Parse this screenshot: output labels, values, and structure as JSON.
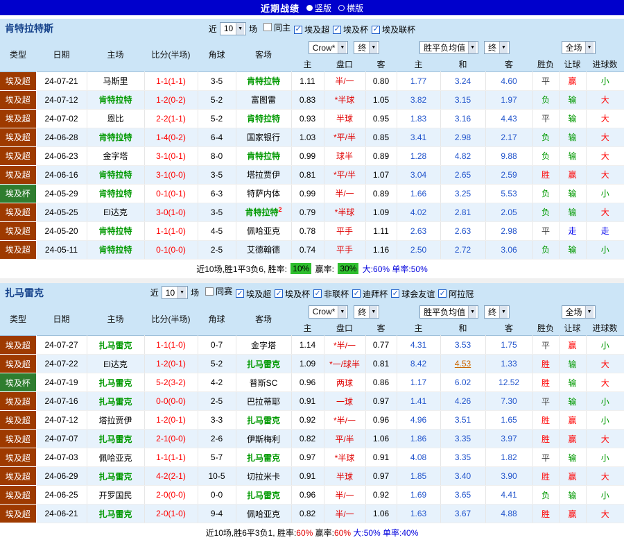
{
  "topbar": {
    "title": "近期战绩",
    "vertical": "竖版",
    "horizontal": "横版"
  },
  "columns": {
    "type": "类型",
    "date": "日期",
    "home": "主场",
    "score": "比分(半场)",
    "corner": "角球",
    "away": "客场",
    "h": "主",
    "hcp": "盘口",
    "a": "客",
    "avg_h": "主",
    "avg_d": "和",
    "avg_a": "客",
    "wdl": "胜负",
    "let": "让球",
    "goals": "进球数"
  },
  "league_colors": {
    "埃及超": "#9E3A00",
    "埃及杯": "#2F7D2F"
  },
  "result_colors": {
    "胜": "#FF0000",
    "赢": "#FF0000",
    "大": "#FF0000",
    "负": "#009900",
    "输": "#009900",
    "小": "#009900",
    "平": "#404040",
    "走": "#0000EE"
  },
  "sections": [
    {
      "team": "肯特拉特斯",
      "filters": {
        "near": "近",
        "count": "10",
        "games": "场",
        "checkboxes": [
          {
            "label": "同主",
            "checked": false
          },
          {
            "label": "埃及超",
            "checked": true
          },
          {
            "label": "埃及杯",
            "checked": true
          },
          {
            "label": "埃及联杯",
            "checked": true
          }
        ]
      },
      "selects": {
        "bookmaker": "Crow*",
        "final1": "终",
        "avg": "胜平负均值",
        "final2": "终",
        "scope": "全场"
      },
      "rows": [
        {
          "league": "埃及超",
          "date": "24-07-21",
          "home": "马斯里",
          "home_hl": false,
          "score": "1-1(1-1)",
          "corner": "3-5",
          "away": "肯特拉特",
          "away_hl": true,
          "h": "1.11",
          "hcp": "半/一",
          "a": "0.80",
          "avg_h": "1.77",
          "avg_d": "3.24",
          "avg_a": "4.60",
          "wdl": "平",
          "let": "赢",
          "goals": "小"
        },
        {
          "league": "埃及超",
          "date": "24-07-12",
          "home": "肯特拉特",
          "home_hl": true,
          "score": "1-2(0-2)",
          "corner": "5-2",
          "away": "富图雷",
          "away_hl": false,
          "h": "0.83",
          "hcp": "*半球",
          "a": "1.05",
          "avg_h": "3.82",
          "avg_d": "3.15",
          "avg_a": "1.97",
          "wdl": "负",
          "let": "输",
          "goals": "大"
        },
        {
          "league": "埃及超",
          "date": "24-07-02",
          "home": "恩比",
          "home_hl": false,
          "score": "2-2(1-1)",
          "corner": "5-2",
          "away": "肯特拉特",
          "away_hl": true,
          "h": "0.93",
          "hcp": "半球",
          "a": "0.95",
          "avg_h": "1.83",
          "avg_d": "3.16",
          "avg_a": "4.43",
          "wdl": "平",
          "let": "输",
          "goals": "大"
        },
        {
          "league": "埃及超",
          "date": "24-06-28",
          "home": "肯特拉特",
          "home_hl": true,
          "score": "1-4(0-2)",
          "corner": "6-4",
          "away": "国家银行",
          "away_hl": false,
          "h": "1.03",
          "hcp": "*平/半",
          "a": "0.85",
          "avg_h": "3.41",
          "avg_d": "2.98",
          "avg_a": "2.17",
          "wdl": "负",
          "let": "输",
          "goals": "大"
        },
        {
          "league": "埃及超",
          "date": "24-06-23",
          "home": "金字塔",
          "home_hl": false,
          "score": "3-1(0-1)",
          "corner": "8-0",
          "away": "肯特拉特",
          "away_hl": true,
          "h": "0.99",
          "hcp": "球半",
          "a": "0.89",
          "avg_h": "1.28",
          "avg_d": "4.82",
          "avg_a": "9.88",
          "wdl": "负",
          "let": "输",
          "goals": "大"
        },
        {
          "league": "埃及超",
          "date": "24-06-16",
          "home": "肯特拉特",
          "home_hl": true,
          "score": "3-1(0-0)",
          "corner": "3-5",
          "away": "塔拉贾伊",
          "away_hl": false,
          "h": "0.81",
          "hcp": "*平/半",
          "a": "1.07",
          "avg_h": "3.04",
          "avg_d": "2.65",
          "avg_a": "2.59",
          "wdl": "胜",
          "let": "赢",
          "goals": "大"
        },
        {
          "league": "埃及杯",
          "date": "24-05-29",
          "home": "肯特拉特",
          "home_hl": true,
          "score": "0-1(0-1)",
          "corner": "6-3",
          "away": "特萨内体",
          "away_hl": false,
          "h": "0.99",
          "hcp": "半/一",
          "a": "0.89",
          "avg_h": "1.66",
          "avg_d": "3.25",
          "avg_a": "5.53",
          "wdl": "负",
          "let": "输",
          "goals": "小"
        },
        {
          "league": "埃及超",
          "date": "24-05-25",
          "home": "El达克",
          "home_hl": false,
          "score": "3-0(1-0)",
          "corner": "3-5",
          "away": "肯特拉特",
          "away_hl": true,
          "away_sup": "2",
          "h": "0.79",
          "hcp": "*半球",
          "a": "1.09",
          "avg_h": "4.02",
          "avg_d": "2.81",
          "avg_a": "2.05",
          "wdl": "负",
          "let": "输",
          "goals": "大"
        },
        {
          "league": "埃及超",
          "date": "24-05-20",
          "home": "肯特拉特",
          "home_hl": true,
          "score": "1-1(1-0)",
          "corner": "4-5",
          "away": "佩哈亚克",
          "away_hl": false,
          "h": "0.78",
          "hcp": "平手",
          "a": "1.11",
          "avg_h": "2.63",
          "avg_d": "2.63",
          "avg_a": "2.98",
          "wdl": "平",
          "let": "走",
          "goals": "走"
        },
        {
          "league": "埃及超",
          "date": "24-05-11",
          "home": "肯特拉特",
          "home_hl": true,
          "score": "0-1(0-0)",
          "corner": "2-5",
          "away": "艾德翰德",
          "away_hl": false,
          "h": "0.74",
          "hcp": "平手",
          "a": "1.16",
          "avg_h": "2.50",
          "avg_d": "2.72",
          "avg_a": "3.06",
          "wdl": "负",
          "let": "输",
          "goals": "小"
        }
      ],
      "summary": [
        {
          "text": "近10场,胜1平3负6, 胜率: ",
          "style": "plain"
        },
        {
          "text": "10%",
          "style": "badge"
        },
        {
          "text": " 赢率: ",
          "style": "plain"
        },
        {
          "text": "30%",
          "style": "badge"
        },
        {
          "text": " 大:60%",
          "style": "blue"
        },
        {
          "text": " 单率:50%",
          "style": "blue"
        }
      ]
    },
    {
      "team": "扎马雷克",
      "filters": {
        "near": "近",
        "count": "10",
        "games": "场",
        "checkboxes": [
          {
            "label": "同赛",
            "checked": false
          },
          {
            "label": "埃及超",
            "checked": true
          },
          {
            "label": "埃及杯",
            "checked": true
          },
          {
            "label": "非联杯",
            "checked": true
          },
          {
            "label": "迪拜杯",
            "checked": true
          },
          {
            "label": "球会友谊",
            "checked": true
          },
          {
            "label": "阿拉冠",
            "checked": true
          }
        ]
      },
      "selects": {
        "bookmaker": "Crow*",
        "final1": "终",
        "avg": "胜平负均值",
        "final2": "终",
        "scope": "全场"
      },
      "rows": [
        {
          "league": "埃及超",
          "date": "24-07-27",
          "home": "扎马雷克",
          "home_hl": true,
          "score": "1-1(1-0)",
          "corner": "0-7",
          "away": "金字塔",
          "away_hl": false,
          "h": "1.14",
          "hcp": "*半/一",
          "a": "0.77",
          "avg_h": "4.31",
          "avg_d": "3.53",
          "avg_a": "1.75",
          "wdl": "平",
          "let": "赢",
          "goals": "小"
        },
        {
          "league": "埃及超",
          "date": "24-07-22",
          "home": "El达克",
          "home_hl": false,
          "score": "1-2(0-1)",
          "corner": "5-2",
          "away": "扎马雷克",
          "away_hl": true,
          "h": "1.09",
          "hcp": "*一/球半",
          "a": "0.81",
          "avg_h": "8.42",
          "avg_d": "4.53",
          "avg_d_hl": true,
          "avg_a": "1.33",
          "wdl": "胜",
          "let": "输",
          "goals": "大"
        },
        {
          "league": "埃及杯",
          "date": "24-07-19",
          "home": "扎马雷克",
          "home_hl": true,
          "score": "5-2(3-2)",
          "corner": "4-2",
          "away": "普斯SC",
          "away_hl": false,
          "h": "0.96",
          "hcp": "两球",
          "a": "0.86",
          "avg_h": "1.17",
          "avg_d": "6.02",
          "avg_a": "12.52",
          "wdl": "胜",
          "let": "输",
          "goals": "大"
        },
        {
          "league": "埃及超",
          "date": "24-07-16",
          "home": "扎马雷克",
          "home_hl": true,
          "score": "0-0(0-0)",
          "corner": "2-5",
          "away": "巴拉蒂耶",
          "away_hl": false,
          "h": "0.91",
          "hcp": "一球",
          "a": "0.97",
          "avg_h": "1.41",
          "avg_d": "4.26",
          "avg_a": "7.30",
          "wdl": "平",
          "let": "输",
          "goals": "小"
        },
        {
          "league": "埃及超",
          "date": "24-07-12",
          "home": "塔拉贾伊",
          "home_hl": false,
          "score": "1-2(0-1)",
          "corner": "3-3",
          "away": "扎马雷克",
          "away_hl": true,
          "h": "0.92",
          "hcp": "*半/一",
          "a": "0.96",
          "avg_h": "4.96",
          "avg_d": "3.51",
          "avg_a": "1.65",
          "wdl": "胜",
          "let": "赢",
          "goals": "小"
        },
        {
          "league": "埃及超",
          "date": "24-07-07",
          "home": "扎马雷克",
          "home_hl": true,
          "score": "2-1(0-0)",
          "corner": "2-6",
          "away": "伊斯梅利",
          "away_hl": false,
          "h": "0.82",
          "hcp": "平/半",
          "a": "1.06",
          "avg_h": "1.86",
          "avg_d": "3.35",
          "avg_a": "3.97",
          "wdl": "胜",
          "let": "赢",
          "goals": "大"
        },
        {
          "league": "埃及超",
          "date": "24-07-03",
          "home": "佩哈亚克",
          "home_hl": false,
          "score": "1-1(1-1)",
          "corner": "5-7",
          "away": "扎马雷克",
          "away_hl": true,
          "h": "0.97",
          "hcp": "*半球",
          "a": "0.91",
          "avg_h": "4.08",
          "avg_d": "3.35",
          "avg_a": "1.82",
          "wdl": "平",
          "let": "输",
          "goals": "小"
        },
        {
          "league": "埃及超",
          "date": "24-06-29",
          "home": "扎马雷克",
          "home_hl": true,
          "score": "4-2(2-1)",
          "corner": "10-5",
          "away": "切拉米卡",
          "away_hl": false,
          "h": "0.91",
          "hcp": "半球",
          "a": "0.97",
          "avg_h": "1.85",
          "avg_d": "3.40",
          "avg_a": "3.90",
          "wdl": "胜",
          "let": "赢",
          "goals": "大"
        },
        {
          "league": "埃及超",
          "date": "24-06-25",
          "home": "开罗国民",
          "home_hl": false,
          "score": "2-0(0-0)",
          "corner": "0-0",
          "away": "扎马雷克",
          "away_hl": true,
          "h": "0.96",
          "hcp": "半/一",
          "a": "0.92",
          "avg_h": "1.69",
          "avg_d": "3.65",
          "avg_a": "4.41",
          "wdl": "负",
          "let": "输",
          "goals": "小"
        },
        {
          "league": "埃及超",
          "date": "24-06-21",
          "home": "扎马雷克",
          "home_hl": true,
          "score": "2-0(1-0)",
          "corner": "9-4",
          "away": "佩哈亚克",
          "away_hl": false,
          "h": "0.82",
          "hcp": "半/一",
          "a": "1.06",
          "avg_h": "1.63",
          "avg_d": "3.67",
          "avg_a": "4.88",
          "wdl": "胜",
          "let": "赢",
          "goals": "大"
        }
      ],
      "summary": [
        {
          "text": "近10场,胜6平3负1, 胜率:",
          "style": "plain"
        },
        {
          "text": "60%",
          "style": "red"
        },
        {
          "text": " 赢率:",
          "style": "plain"
        },
        {
          "text": "60%",
          "style": "red"
        },
        {
          "text": " 大:50%",
          "style": "blue"
        },
        {
          "text": " 单率:40%",
          "style": "blue"
        }
      ]
    }
  ]
}
